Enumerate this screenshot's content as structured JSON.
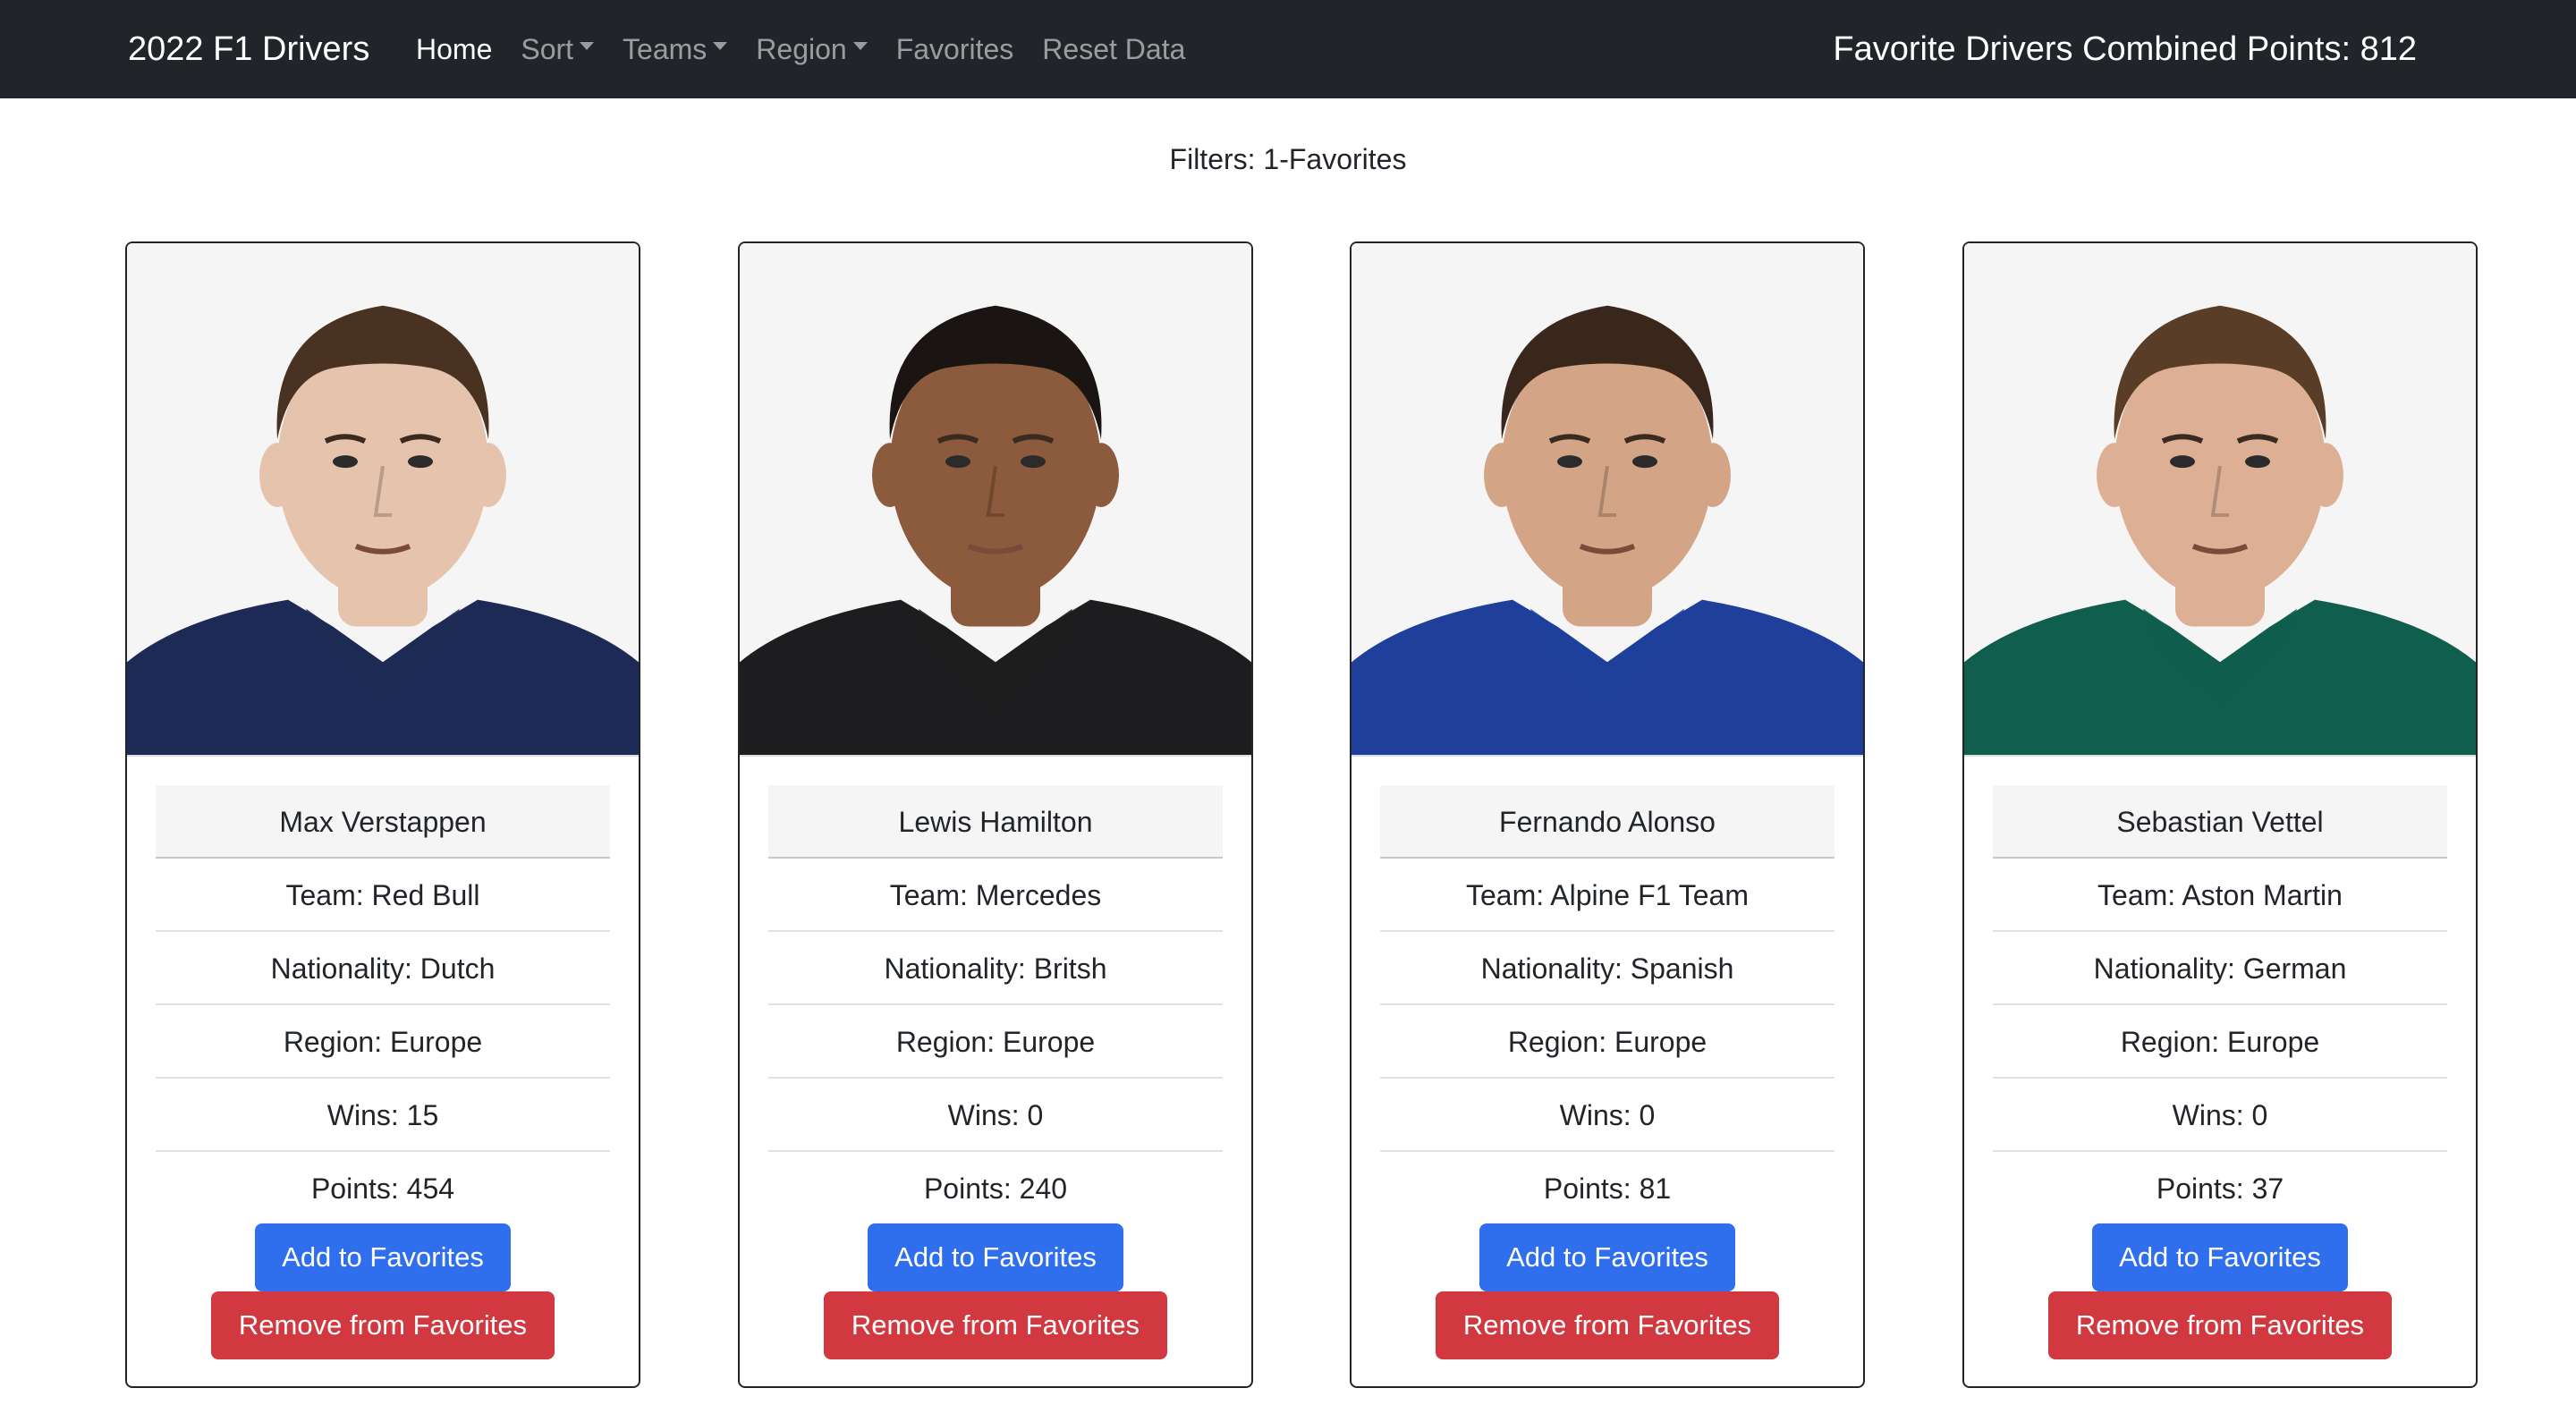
{
  "navbar": {
    "brand": "2022 F1 Drivers",
    "links": [
      {
        "label": "Home",
        "active": true,
        "dropdown": false
      },
      {
        "label": "Sort",
        "active": false,
        "dropdown": true
      },
      {
        "label": "Teams",
        "active": false,
        "dropdown": true
      },
      {
        "label": "Region",
        "active": false,
        "dropdown": true
      },
      {
        "label": "Favorites",
        "active": false,
        "dropdown": false
      },
      {
        "label": "Reset Data",
        "active": false,
        "dropdown": false
      }
    ],
    "points_total": "Favorite Drivers Combined Points: 812"
  },
  "filters": "Filters: 1-Favorites",
  "buttons": {
    "add": "Add to Favorites",
    "remove": "Remove from Favorites"
  },
  "drivers": [
    {
      "name": "Max Verstappen",
      "team": "Team: Red Bull",
      "nationality": "Nationality: Dutch",
      "region": "Region: Europe",
      "wins": "Wins: 15",
      "points": "Points: 454",
      "suit_color": "#1c2a55",
      "hair_color": "#4a3222",
      "skin_color": "#e6c3ac"
    },
    {
      "name": "Lewis Hamilton",
      "team": "Team: Mercedes",
      "nationality": "Nationality: Britsh",
      "region": "Region: Europe",
      "wins": "Wins: 0",
      "points": "Points: 240",
      "suit_color": "#1d1d1f",
      "hair_color": "#1a1412",
      "skin_color": "#8c5a3c"
    },
    {
      "name": "Fernando Alonso",
      "team": "Team: Alpine F1 Team",
      "nationality": "Nationality: Spanish",
      "region": "Region: Europe",
      "wins": "Wins: 0",
      "points": "Points: 81",
      "suit_color": "#1f3f9a",
      "hair_color": "#3a271b",
      "skin_color": "#d4a487"
    },
    {
      "name": "Sebastian Vettel",
      "team": "Team: Aston Martin",
      "nationality": "Nationality: German",
      "region": "Region: Europe",
      "wins": "Wins: 0",
      "points": "Points: 37",
      "suit_color": "#0f5e4e",
      "hair_color": "#5a3d27",
      "skin_color": "#ddb096"
    }
  ]
}
